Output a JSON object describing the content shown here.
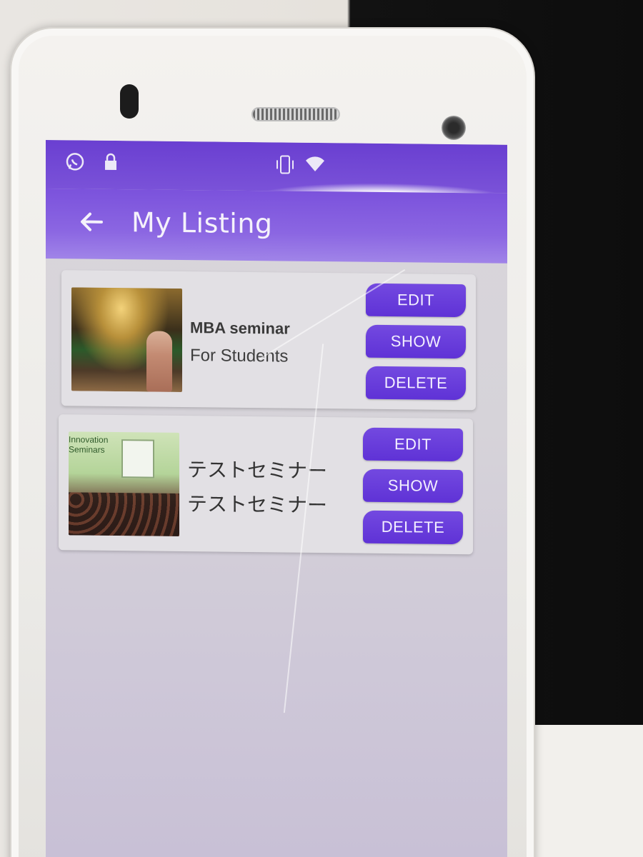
{
  "app": {
    "title": "My Listing"
  },
  "statusbar": {
    "left_icons": [
      "whatsapp-icon",
      "lock-icon"
    ],
    "right_icons": [
      "vibrate-icon",
      "wifi-icon",
      "signal-icon"
    ]
  },
  "colors": {
    "primary": "#6a3fd1",
    "button": "#6536da",
    "card": "#e2e0e4"
  },
  "listings": [
    {
      "title": "MBA seminar",
      "subtitle": "For Students",
      "edit_label": "EDIT",
      "show_label": "SHOW",
      "delete_label": "DELETE"
    },
    {
      "title": "テストセミナー",
      "subtitle": "テストセミナー",
      "thumb_banner": "Innovation Seminars",
      "edit_label": "EDIT",
      "show_label": "SHOW",
      "delete_label": "DELETE"
    }
  ]
}
